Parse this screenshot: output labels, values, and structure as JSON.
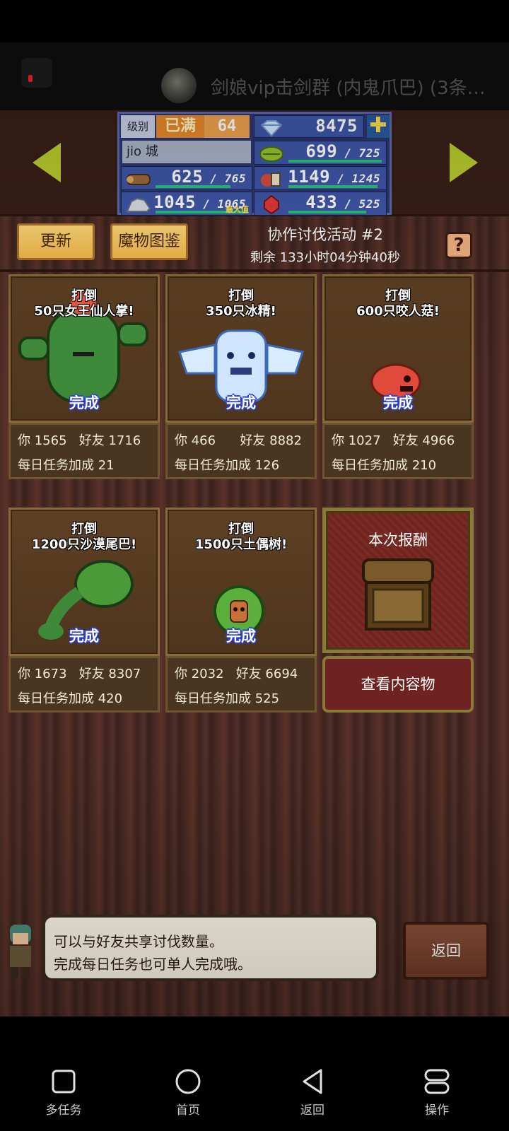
{
  "notification": {
    "message": "剑娘vip击剑群 (内鬼爪巴) (3条…"
  },
  "status": {
    "level_label": "级别",
    "level_full": "已满",
    "level": "64",
    "player_name": "jio 城",
    "gems": "8475",
    "wood": "625",
    "wood_max": "765",
    "stone": "1045",
    "stone_max": "1065",
    "stone_max_tag": "最大值",
    "grass": "699",
    "grass_max": "725",
    "food": "1149",
    "food_max": "1245",
    "ruby": "433",
    "ruby_max": "525"
  },
  "controls": {
    "refresh_label": "更新",
    "bestiary_label": "魔物图鉴",
    "event_title": "协作讨伐活动 #2",
    "event_time": "剩余 133小时04分钟40秒",
    "help_label": "?"
  },
  "cards": [
    {
      "target_line1": "打倒",
      "target_line2": "50只女王仙人掌!",
      "done": "完成",
      "you": "你 1565",
      "friend": "好友 1716",
      "bonus": "每日任务加成 21"
    },
    {
      "target_line1": "打倒",
      "target_line2": "350只冰精!",
      "done": "完成",
      "you": "你 466",
      "friend": "好友 8882",
      "bonus": "每日任务加成 126"
    },
    {
      "target_line1": "打倒",
      "target_line2": "600只咬人菇!",
      "done": "完成",
      "you": "你 1027",
      "friend": "好友 4966",
      "bonus": "每日任务加成 210"
    },
    {
      "target_line1": "打倒",
      "target_line2": "1200只沙漠尾巴!",
      "done": "完成",
      "you": "你 1673",
      "friend": "好友 8307",
      "bonus": "每日任务加成 420"
    },
    {
      "target_line1": "打倒",
      "target_line2": "1500只土偶树!",
      "done": "完成",
      "you": "你 2032",
      "friend": "好友 6694",
      "bonus": "每日任务加成 525"
    }
  ],
  "reward": {
    "title": "本次报酬",
    "button_label": "查看内容物"
  },
  "dialog": {
    "line1": "可以与好友共享讨伐数量。",
    "line2": "完成每日任务也可单人完成哦。",
    "back_label": "返回"
  },
  "navbar": {
    "items": [
      {
        "label": "多任务",
        "icon": "square-icon"
      },
      {
        "label": "首页",
        "icon": "circle-icon"
      },
      {
        "label": "返回",
        "icon": "triangle-back-icon"
      },
      {
        "label": "操作",
        "icon": "operation-icon"
      }
    ]
  }
}
